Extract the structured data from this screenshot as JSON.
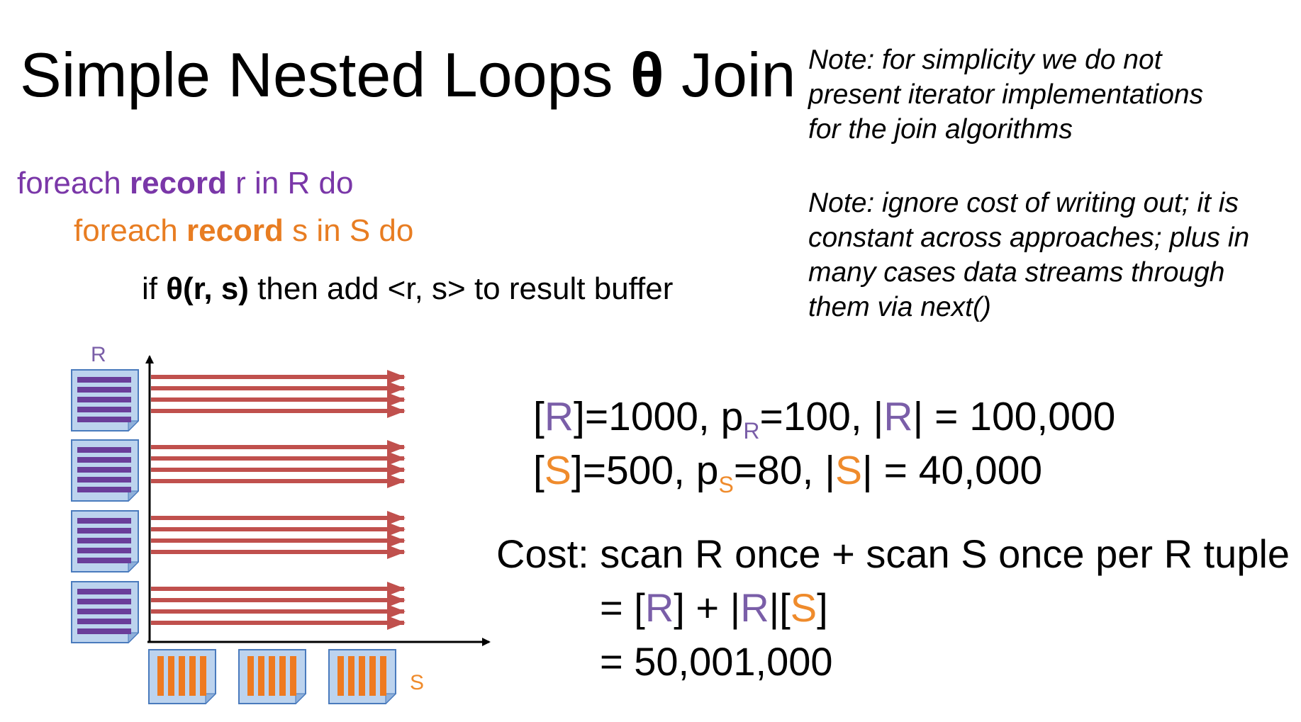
{
  "title": {
    "text": "Simple Nested Loops",
    "theta": "θ",
    "suffix": "Join"
  },
  "notes": {
    "note1": [
      "Note: for simplicity we do not",
      "present iterator implementations",
      "for the join algorithms"
    ],
    "note2": [
      "Note: ignore cost of writing out; it is",
      "constant across approaches; plus in",
      "many cases data streams through",
      "them via next()"
    ]
  },
  "code": {
    "line1": {
      "pre": "foreach ",
      "kw": "record",
      "post": " r in R do"
    },
    "line2": {
      "pre": "foreach ",
      "kw": "record",
      "post": " s in S do"
    },
    "line3": {
      "pre": "if ",
      "cond": "θ(r, s)",
      "post": "  then add <r, s> to result buffer"
    }
  },
  "stats": {
    "r": {
      "open": "[",
      "name": "R",
      "close": "]=1000, p",
      "sub": "R",
      "mid": "=100, |",
      "name2": "R",
      "end": "| = 100,000"
    },
    "s": {
      "open": "[",
      "name": "S",
      "close": "]=500, p",
      "sub": "S",
      "mid": "=80, |",
      "name2": "S",
      "end": "| = 40,000"
    }
  },
  "cost": {
    "line1": "Cost:  scan R once + scan S once per R tuple",
    "line2": {
      "a": "= [",
      "r1": "R",
      "b": "] + |",
      "r2": "R",
      "c": "|[",
      "s1": "S",
      "d": "]"
    },
    "line3": "= 50,001,000"
  },
  "diagram": {
    "r_label": "R",
    "s_label": "S",
    "r_pages": 4,
    "s_pages": 3,
    "arrows_per_page": 4,
    "colors": {
      "r": "#7a5ea8",
      "s": "#ef8b2c",
      "arrow": "#c0504d",
      "page_fill": "#bcd3ee",
      "page_border": "#4a7bbd",
      "r_stripe": "#6a3d9a",
      "s_stripe": "#ee7a20"
    }
  }
}
